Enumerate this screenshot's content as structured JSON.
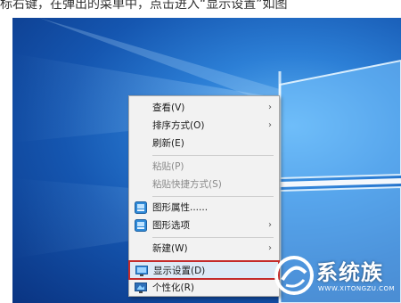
{
  "caption": "标右键，在弹出的菜单中，点击进入“显示设置”如图",
  "context_menu": {
    "items": [
      {
        "label": "查看(V)",
        "has_submenu": true,
        "enabled": true
      },
      {
        "label": "排序方式(O)",
        "has_submenu": true,
        "enabled": true
      },
      {
        "label": "刷新(E)",
        "has_submenu": false,
        "enabled": true
      },
      {
        "label": "粘贴(P)",
        "has_submenu": false,
        "enabled": false
      },
      {
        "label": "粘贴快捷方式(S)",
        "has_submenu": false,
        "enabled": false
      },
      {
        "label": "图形属性......",
        "icon": "intel-graphics-icon",
        "has_submenu": false,
        "enabled": true
      },
      {
        "label": "图形选项",
        "icon": "intel-graphics-icon",
        "has_submenu": true,
        "enabled": true
      },
      {
        "label": "新建(W)",
        "has_submenu": true,
        "enabled": true
      },
      {
        "label": "显示设置(D)",
        "icon": "display-settings-icon",
        "has_submenu": false,
        "enabled": true,
        "highlighted": true
      },
      {
        "label": "个性化(R)",
        "icon": "personalize-icon",
        "has_submenu": false,
        "enabled": true
      }
    ],
    "submenu_arrow": "›"
  },
  "watermark": {
    "title": "系统族",
    "url": "WWW.XITONGZU.COM"
  },
  "colors": {
    "highlight_border": "#c42b2b",
    "desktop_blue": "#1556b0"
  }
}
